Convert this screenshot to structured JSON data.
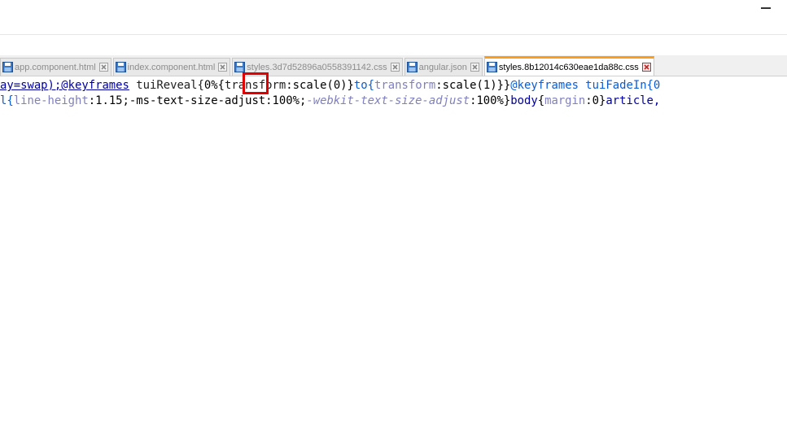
{
  "tabs": [
    {
      "label": "app.component.html",
      "active": false
    },
    {
      "label": "index.component.html",
      "active": false
    },
    {
      "label": "styles.3d7d52896a0558391142.css",
      "active": false
    },
    {
      "label": "angular.json",
      "active": false
    },
    {
      "label": "styles.8b12014c630eae1da88c.css",
      "active": true
    }
  ],
  "editor": {
    "line1": {
      "s1": "ay=swap);@keyframes",
      "s2": " tuiReveal{",
      "s3": "0%{",
      "s4": "transform",
      "s5": ":scale(0)}",
      "s6": "to{",
      "s7": "transform",
      "s8": ":scale(1)}}",
      "s9": "@keyframes tuiFadeIn{0"
    },
    "line2": {
      "s1": "l{",
      "s2": "line-height",
      "s3": ":1.15;-ms-text-size-adjust:100%;",
      "s4": "-webkit-text-size-adjust",
      "s5": ":100%}",
      "s6": "body",
      "s7": "{",
      "s8": "margin",
      "s9": ":0}",
      "s10": "article,"
    }
  },
  "colors": {
    "active_tab_accent": "#fa9c1e",
    "highlight_box": "#e00000",
    "keyword": "#0b5cd5",
    "property": "#8080c0"
  }
}
